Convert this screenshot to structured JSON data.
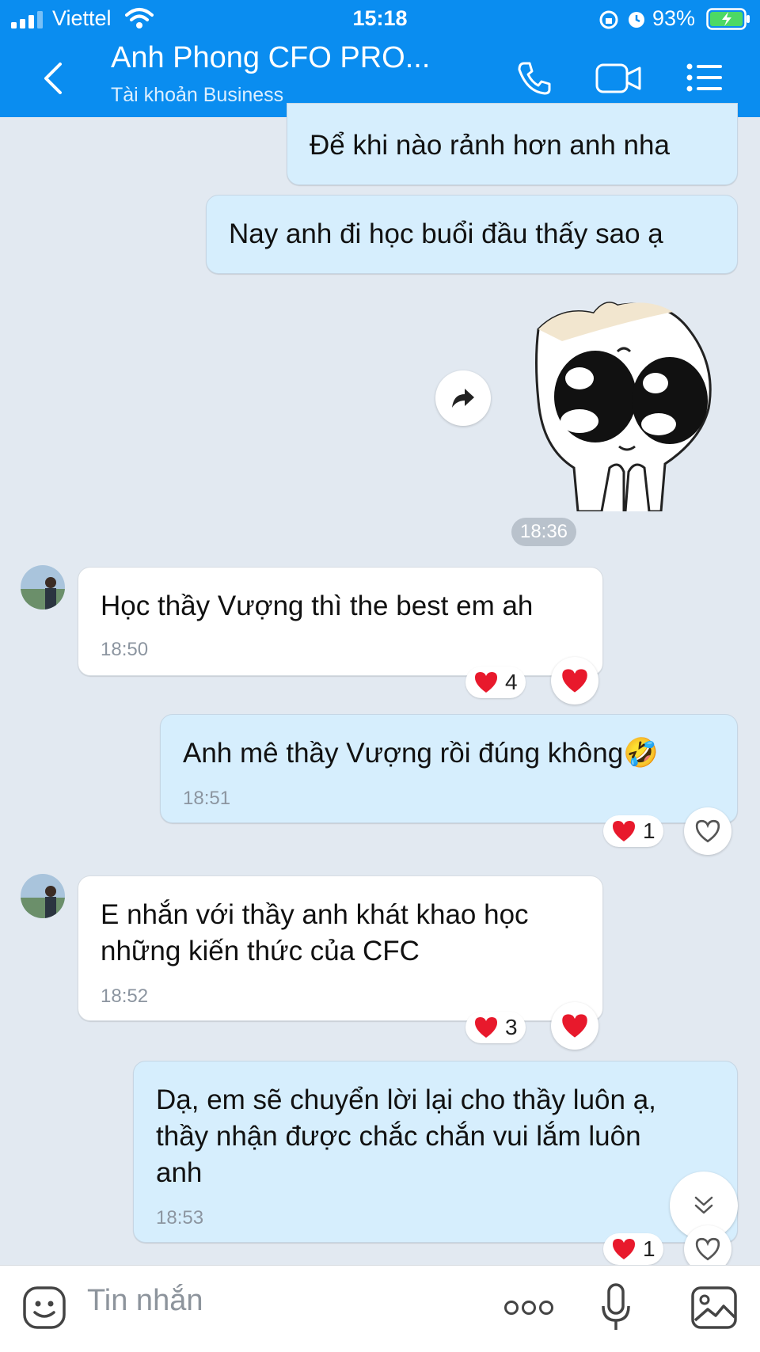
{
  "status_bar": {
    "carrier": "Viettel",
    "time": "15:18",
    "battery": "93%"
  },
  "header": {
    "title": "Anh Phong CFO PRO...",
    "subtitle": "Tài khoản Business"
  },
  "messages": [
    {
      "text": "Để khi nào rảnh hơn anh nha"
    },
    {
      "text": "Nay anh đi học buổi đầu thấy sao ạ"
    },
    {
      "text": "Học thầy Vượng thì the best em ah",
      "time": "18:50",
      "reaction_count": "4"
    },
    {
      "text": "Anh mê thầy Vượng rồi đúng không",
      "emoji": "🤣",
      "time": "18:51",
      "reaction_count": "1"
    },
    {
      "lines": [
        "E nhắn với thầy anh khát khao học",
        "những kiến thức của CFC"
      ],
      "time": "18:52",
      "reaction_count": "3"
    },
    {
      "lines": [
        "Dạ, em sẽ chuyển lời lại cho thầy luôn ạ,",
        "thầy nhận được chắc chắn vui lắm luôn",
        "anh"
      ],
      "time": "18:53",
      "reaction_count": "1"
    }
  ],
  "sticker_time": "18:36",
  "input": {
    "placeholder": "Tin nhắn"
  },
  "colors": {
    "header": "#0a8df0",
    "sent_bubble": "#d6eefd",
    "received_bubble": "#ffffff",
    "background": "#e2e9f1",
    "heart": "#e8192c"
  }
}
